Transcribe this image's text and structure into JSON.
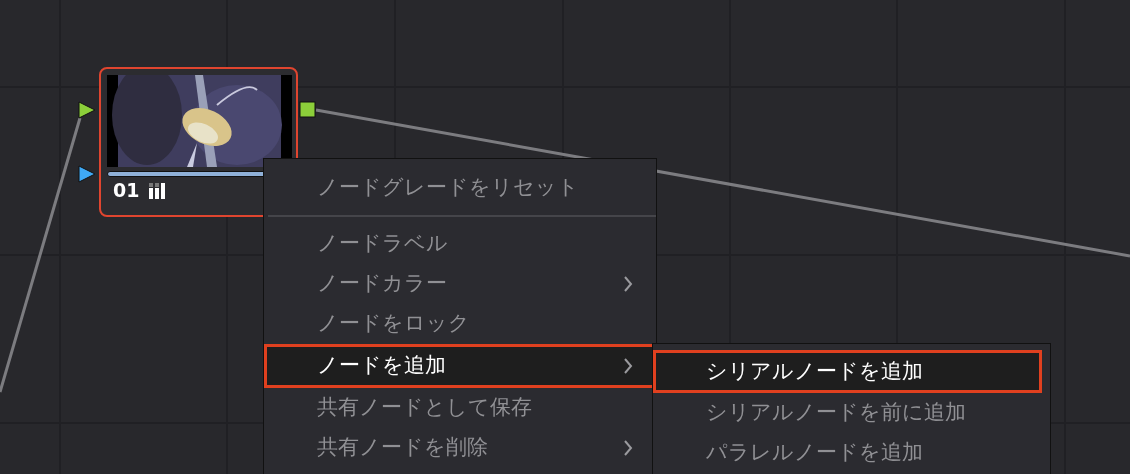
{
  "node": {
    "label": "01",
    "selected": true
  },
  "context_menu": {
    "items": [
      {
        "kind": "item",
        "label": "ノードグレードをリセット",
        "selected": false,
        "submenu": false
      },
      {
        "kind": "separator"
      },
      {
        "kind": "item",
        "label": "ノードラベル",
        "selected": false,
        "submenu": false
      },
      {
        "kind": "item",
        "label": "ノードカラー",
        "selected": false,
        "submenu": true
      },
      {
        "kind": "item",
        "label": "ノードをロック",
        "selected": false,
        "submenu": false
      },
      {
        "kind": "item",
        "label": "ノードを追加",
        "selected": true,
        "submenu": true
      },
      {
        "kind": "item",
        "label": "共有ノードとして保存",
        "selected": false,
        "submenu": false
      },
      {
        "kind": "item",
        "label": "共有ノードを削除",
        "selected": false,
        "submenu": true
      }
    ]
  },
  "submenu": {
    "items": [
      {
        "label": "シリアルノードを追加",
        "selected": true
      },
      {
        "label": "シリアルノードを前に追加",
        "selected": false
      },
      {
        "label": "パラレルノードを追加",
        "selected": false
      }
    ]
  }
}
